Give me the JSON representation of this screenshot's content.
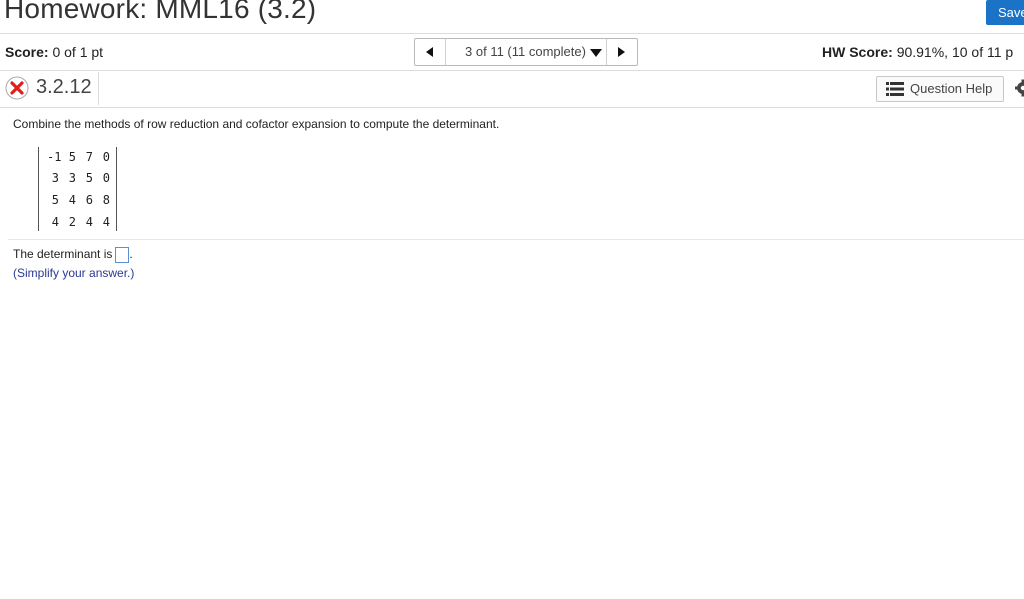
{
  "header": {
    "title": "Homework: MML16 (3.2)",
    "save_label": "Save",
    "save_color": "#1a73c6"
  },
  "score": {
    "label": "Score:",
    "value": "0 of 1 pt"
  },
  "nav": {
    "position_text": "3 of 11 (11 complete)"
  },
  "hw_score": {
    "label": "HW Score:",
    "value": "90.91%, 10 of 11 p"
  },
  "question": {
    "status_icon": "incorrect-x-icon",
    "number": "3.2.12",
    "help_label": "Question Help",
    "instruction": "Combine the methods of row reduction and cofactor expansion to compute the determinant.",
    "matrix": [
      [
        "-1",
        "5",
        "7",
        "0"
      ],
      [
        "3",
        "3",
        "5",
        "0"
      ],
      [
        "5",
        "4",
        "6",
        "8"
      ],
      [
        "4",
        "2",
        "4",
        "4"
      ]
    ],
    "answer_prefix": "The determinant is",
    "answer_value": "",
    "answer_suffix": ".",
    "hint": "(Simplify your answer.)"
  }
}
